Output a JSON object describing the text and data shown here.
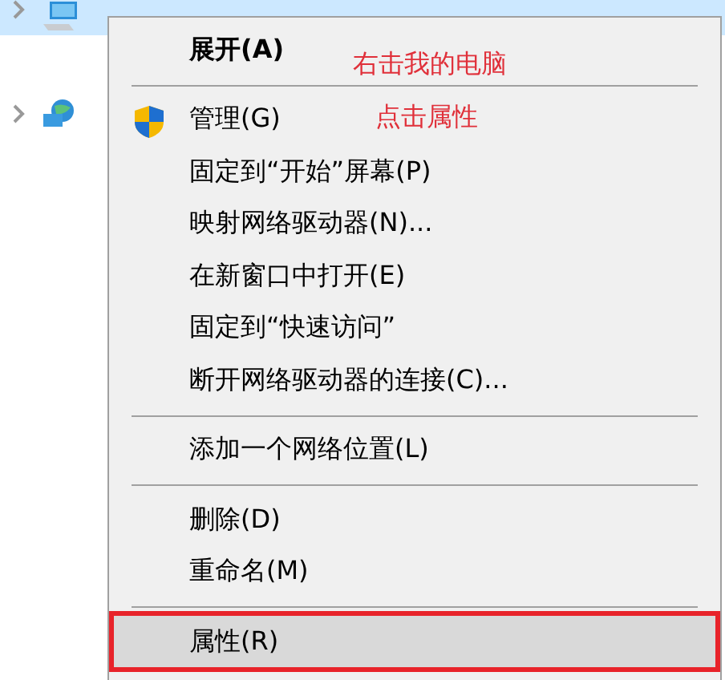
{
  "tree": [
    {
      "kind": "computer",
      "selected": true
    },
    {
      "kind": "network",
      "selected": false
    }
  ],
  "context_menu": {
    "items": [
      {
        "kind": "default",
        "label": "展开(A)",
        "selected": false
      },
      {
        "kind": "separator"
      },
      {
        "kind": "shield",
        "label": "管理(G)",
        "selected": false
      },
      {
        "kind": "item",
        "label": "固定到“开始”屏幕(P)",
        "selected": false
      },
      {
        "kind": "item",
        "label": "映射网络驱动器(N)...",
        "selected": false
      },
      {
        "kind": "item",
        "label": "在新窗口中打开(E)",
        "selected": false
      },
      {
        "kind": "item",
        "label": "固定到“快速访问”",
        "selected": false
      },
      {
        "kind": "item",
        "label": "断开网络驱动器的连接(C)...",
        "selected": false
      },
      {
        "kind": "separator"
      },
      {
        "kind": "item",
        "label": "添加一个网络位置(L)",
        "selected": false
      },
      {
        "kind": "separator"
      },
      {
        "kind": "item",
        "label": "删除(D)",
        "selected": false
      },
      {
        "kind": "item",
        "label": "重命名(M)",
        "selected": false
      },
      {
        "kind": "separator"
      },
      {
        "kind": "item",
        "label": "属性(R)",
        "selected": true
      }
    ]
  },
  "annotations": [
    "右击我的电脑",
    "点击属性"
  ]
}
